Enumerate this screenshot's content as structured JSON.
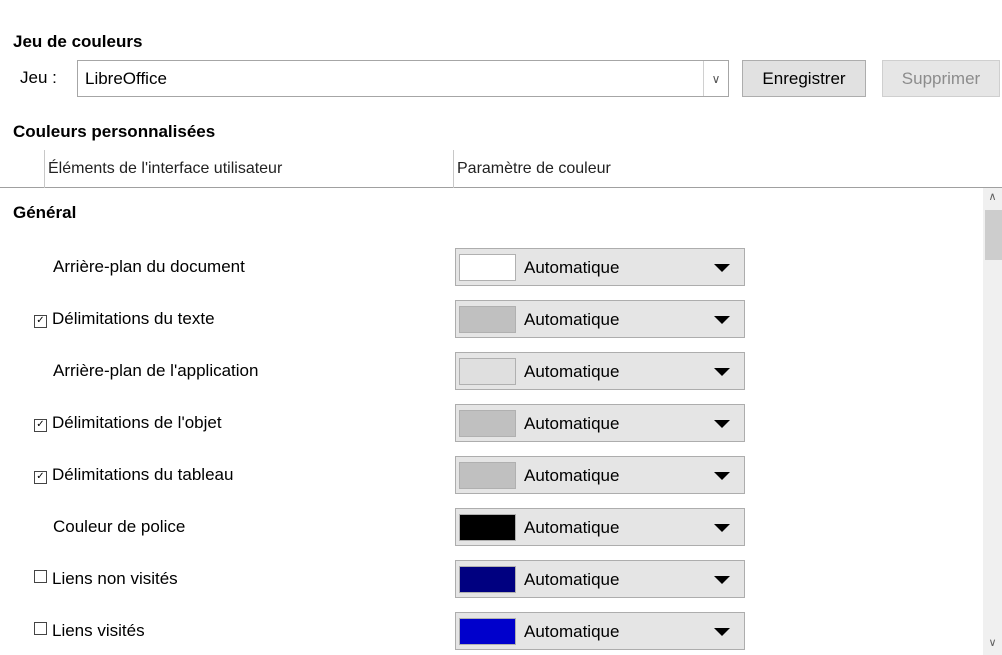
{
  "scheme_section": {
    "title": "Jeu de couleurs",
    "scheme_label": "Jeu :",
    "scheme_value": "LibreOffice",
    "save_button": "Enregistrer",
    "delete_button": "Supprimer"
  },
  "custom_section": {
    "title": "Couleurs personnalisées",
    "col_ui": "Éléments de l'interface utilisateur",
    "col_color": "Paramètre de couleur",
    "group": "Général"
  },
  "rows": [
    {
      "checkbox": "none",
      "label": "Arrière-plan du document",
      "color": "#ffffff",
      "value": "Automatique"
    },
    {
      "checkbox": "checked",
      "label": "Délimitations du texte",
      "color": "#c0c0c0",
      "value": "Automatique"
    },
    {
      "checkbox": "none",
      "label": "Arrière-plan de l'application",
      "color": "#dfdfdf",
      "value": "Automatique"
    },
    {
      "checkbox": "checked",
      "label": "Délimitations de l'objet",
      "color": "#c0c0c0",
      "value": "Automatique"
    },
    {
      "checkbox": "checked",
      "label": "Délimitations du tableau",
      "color": "#c0c0c0",
      "value": "Automatique"
    },
    {
      "checkbox": "none",
      "label": "Couleur de police",
      "color": "#000000",
      "value": "Automatique"
    },
    {
      "checkbox": "unchecked",
      "label": "Liens non visités",
      "color": "#000080",
      "value": "Automatique"
    },
    {
      "checkbox": "unchecked",
      "label": "Liens visités",
      "color": "#0000cc",
      "value": "Automatique"
    }
  ]
}
